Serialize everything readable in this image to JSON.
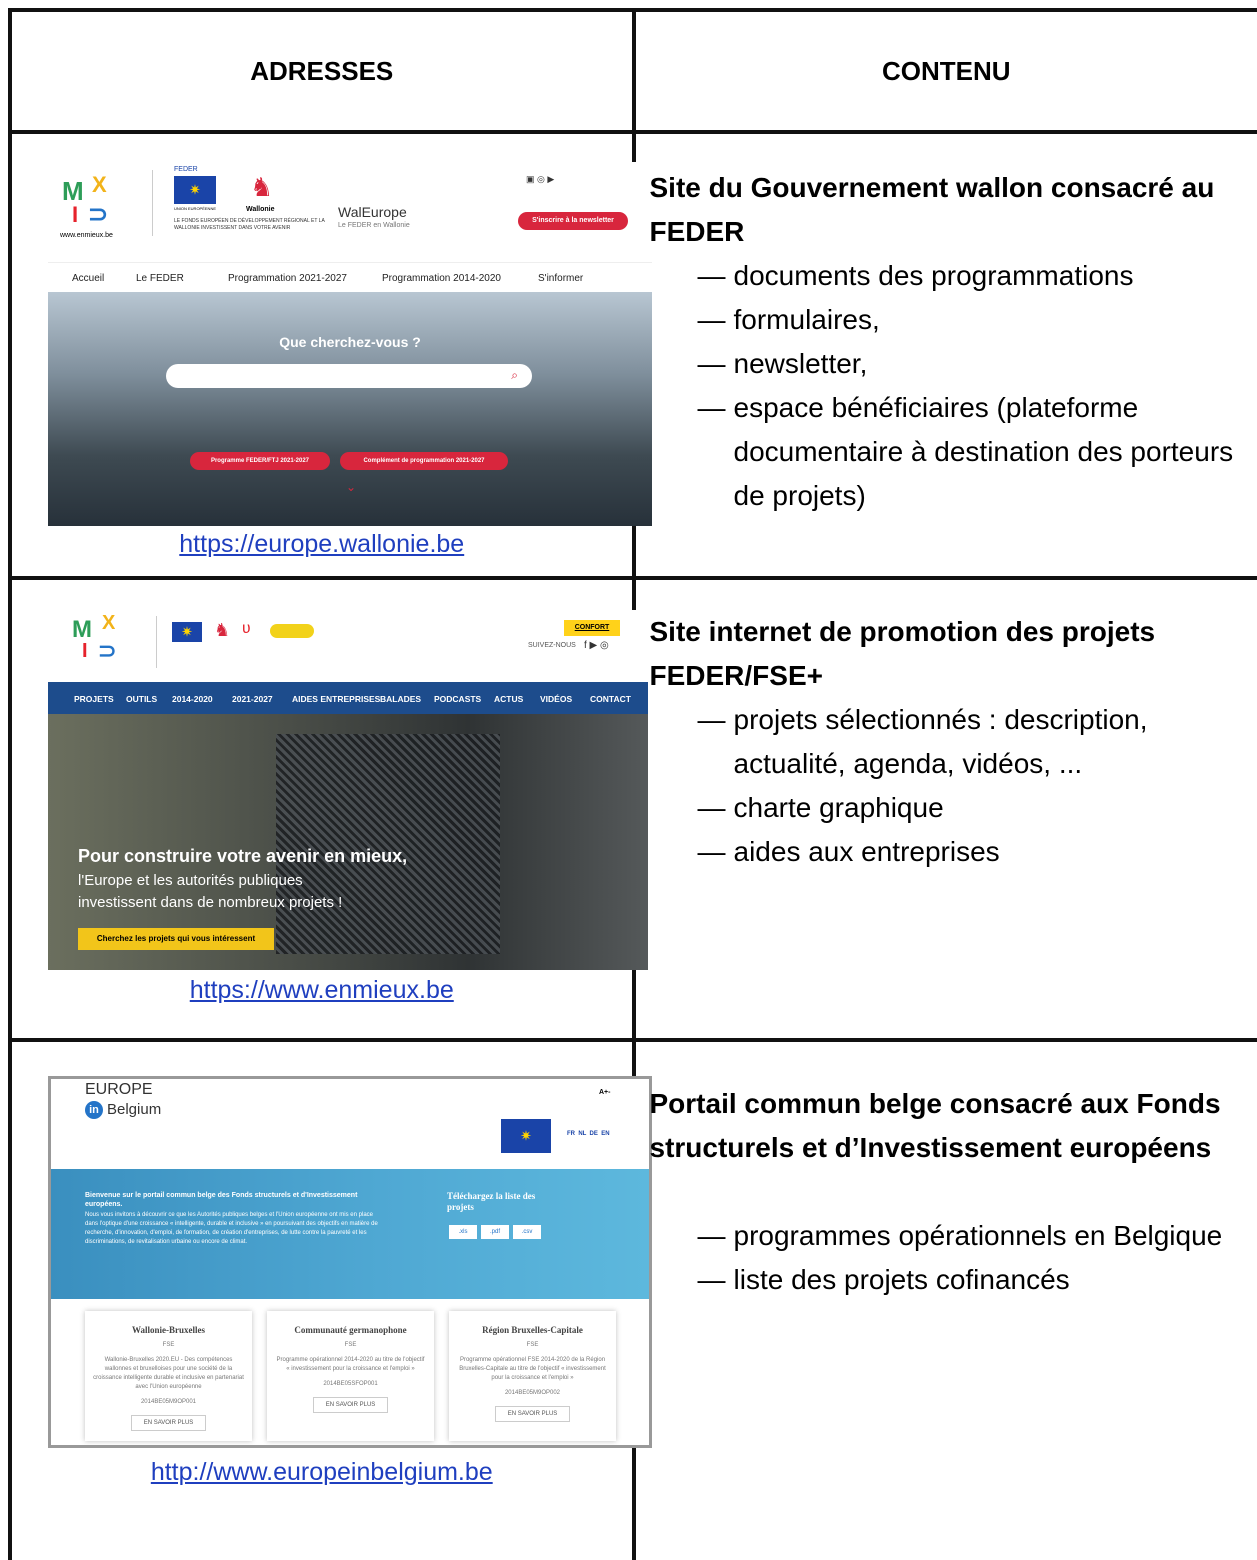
{
  "headers": {
    "addresses": "ADRESSES",
    "contents": "CONTENU"
  },
  "rows": [
    {
      "url": "https://europe.wallonie.be",
      "title": "Site du Gouvernement wallon consacré au FEDER",
      "items": [
        "documents des programmations",
        "formulaires,",
        "newsletter,",
        "espace bénéficiaires (plateforme documentaire à destination des porteurs de projets)"
      ],
      "shot": {
        "feder": "FEDER",
        "union": "UNION EUROPÉENNE",
        "wallonie": "Wallonie",
        "fonds_text": "LE FONDS EUROPÉEN DE DÉVELOPPEMENT RÉGIONAL ET LA WALLONIE INVESTISSENT DANS VOTRE AVENIR",
        "site_name": "WalEurope",
        "site_sub": "Le FEDER en Wallonie",
        "newsletter": "S'inscrire à la newsletter",
        "logo_url": "www.enmieux.be",
        "nav": [
          "Accueil",
          "Le FEDER",
          "Programmation 2021-2027",
          "Programmation 2014-2020",
          "S'informer"
        ],
        "search_prompt": "Que cherchez-vous ?",
        "buttons": [
          "Programme FEDER/FTJ 2021-2027",
          "Complément de programmation 2021-2027"
        ]
      }
    },
    {
      "url": "https://www.enmieux.be",
      "title": "Site internet de promotion des projets FEDER/FSE+",
      "items": [
        "projets sélectionnés : description, actualité, agenda, vidéos, ...",
        "charte graphique",
        "aides aux entreprises"
      ],
      "shot": {
        "confort": "CONFORT",
        "suivez": "SUIVEZ-NOUS",
        "nav": [
          "PROJETS",
          "OUTILS",
          "2014-2020",
          "2021-2027",
          "AIDES ENTREPRISES",
          "BALADES",
          "PODCASTS",
          "ACTUS",
          "VIDÉOS",
          "CONTACT"
        ],
        "headline": "Pour construire votre avenir en mieux,",
        "sub1": "l'Europe et les autorités publiques",
        "sub2": "investissent dans de nombreux projets !",
        "cta": "Cherchez les projets qui vous intéressent"
      }
    },
    {
      "url": "http://www.europeinbelgium.be",
      "title": "Portail commun belge consacré aux Fonds structurels et d’Investissement européens",
      "items": [
        "programmes opérationnels en Belgique",
        "liste des projets cofinancés"
      ],
      "shot": {
        "logo_top": "EUROPE",
        "logo_in": "in",
        "logo_belgium": "Belgium",
        "font_size": "A+-",
        "langs": "FR  NL  DE  EN",
        "welcome_title": "Bienvenue sur le portail commun belge des Fonds structurels et d'Investissement européens.",
        "welcome_text": "Nous vous invitons à découvrir ce que les Autorités publiques belges et l'Union européenne ont mis en place dans l'optique d'une croissance « intelligente, durable et inclusive » en poursuivant des objectifs en matière de recherche, d'innovation, d'emploi, de formation, de création d'entreprises, de lutte contre la pauvreté et les discriminations, de revitalisation urbaine ou encore de climat.",
        "download": "Téléchargez la liste des projets",
        "formats": [
          ".xls",
          ".pdf",
          ".csv"
        ],
        "cards": [
          {
            "title": "Wallonie-Bruxelles",
            "fund": "FSE",
            "text": "Wallonie-Bruxelles 2020.EU - Des compétences wallonnes et bruxelloises pour une société de la croissance intelligente durable et inclusive en partenariat avec l'Union européenne",
            "code": "2014BE05M9OP001",
            "btn": "EN SAVOIR PLUS"
          },
          {
            "title": "Communauté germanophone",
            "fund": "FSE",
            "text": "Programme opérationnel 2014-2020 au titre de l'objectif « investissement pour la croissance et l'emploi »",
            "code": "2014BE05SFOP001",
            "btn": "EN SAVOIR PLUS"
          },
          {
            "title": "Région Bruxelles-Capitale",
            "fund": "FSE",
            "text": "Programme opérationnel FSE 2014-2020 de la Région Bruxelles-Capitale au titre de l'objectif « investissement pour la croissance et l'emploi »",
            "code": "2014BE05M9OP002",
            "btn": "EN SAVOIR PLUS"
          }
        ]
      }
    }
  ]
}
